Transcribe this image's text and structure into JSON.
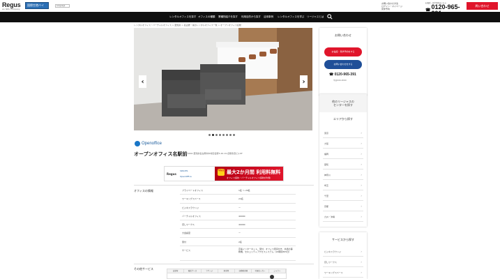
{
  "header": {
    "logo": "Regus",
    "logo_sub": "an IWG company",
    "partner_badge": "国際空港バイ",
    "lang": "Language",
    "top_links": [
      "お問い合わせ方法",
      "ログイン・マイページ",
      "見学予約",
      "ご利用中の方"
    ],
    "phone_label": "お電話・見学予約はこちら",
    "phone": "0120-965-391",
    "inquiry": "問い合わせ"
  },
  "nav": {
    "items": [
      "レンタルオフィスを探す",
      "オフィスの種類",
      "業種別紹介を探す",
      "利用目的から探す",
      "活用事例",
      "レンタルオフィスを学ぶ",
      "リージャスとは"
    ]
  },
  "breadcrumb": "レンタルオフィス・バーチャルオフィス > 愛知県 > 名古屋・栄のレンタルオフィス一覧 > オープンオフィス名駅",
  "office": {
    "brand": "Openoffice",
    "title": "オープンオフィス名駅前",
    "address": "〒450-0002 愛知県名古屋市中村区名駅3-26-19 名駅永田ビル6F"
  },
  "banner": {
    "left_brand": "Regus",
    "left_other1": "SPACES",
    "left_other2": "OpenOffice",
    "badge": "今なら",
    "main": "最大2か月間 利用料無料",
    "sub": "オフィス契約・バーチャルオフィス契約が対象"
  },
  "spec": {
    "label": "オフィスの情報",
    "rows": [
      {
        "k": "プライベートオフィス",
        "v": "1名 〜 20名"
      },
      {
        "k": "ワーキングスペース",
        "v": "24名"
      },
      {
        "k": "ビジネスラウンジ",
        "v": "ー"
      },
      {
        "k": "バーチャルオフィス",
        "v": "40000"
      },
      {
        "k": "貸しワークス",
        "v": "40000"
      },
      {
        "k": "大会議室",
        "v": "ー"
      },
      {
        "k": "受付",
        "v": "2名"
      },
      {
        "k": "サービス",
        "v": "高速インターネット、受付、オフィス家具付き、共通の事務機、セキュリティアクセスシステム（24時間365日）"
      }
    ]
  },
  "other": {
    "label": "その他サービス",
    "headers": [
      "会議室",
      "電話ブース",
      "ラウンジ",
      "駐車場",
      "自動販売機",
      "宅配ロッカー",
      "シャワー"
    ]
  },
  "sidebar": {
    "contact_title": "お問い合わせ",
    "btn_visit": "お電話・見学予約をする",
    "btn_online": "お問い合わせをする",
    "phone": "0120-965-391",
    "hours": "平日9:00-18:00",
    "search_head": "他のリージャスの\nセンターを探す",
    "area_title": "エリアから探す",
    "areas": [
      "東京",
      "大阪",
      "福岡",
      "愛知",
      "神奈川",
      "埼玉",
      "千葉",
      "京都",
      "北海道",
      "九州・沖縄"
    ],
    "service_title": "サービスから探す",
    "services": [
      "ビジネスラウンジ",
      "貸しワークス",
      "ワーキングスペース"
    ]
  },
  "photo_dots": 8
}
